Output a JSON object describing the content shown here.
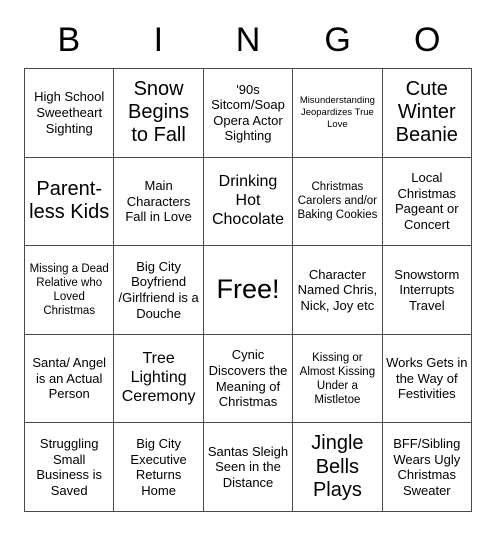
{
  "header": {
    "letters": [
      "B",
      "I",
      "N",
      "G",
      "O"
    ]
  },
  "grid": {
    "rows": 5,
    "columns": 5,
    "border_color": "#4a4a4a",
    "background_color": "#ffffff",
    "text_color": "#000000",
    "cells": [
      {
        "text": "High School Sweetheart Sighting",
        "size": "fs-md"
      },
      {
        "text": "Snow Begins to Fall",
        "size": "fs-xl"
      },
      {
        "text": "'90s Sitcom/Soap Opera Actor Sighting",
        "size": "fs-md"
      },
      {
        "text": "Misunderstanding Jeopardizes True Love",
        "size": "fs-xs"
      },
      {
        "text": "Cute Winter Beanie",
        "size": "fs-xl"
      },
      {
        "text": "Parent-less Kids",
        "size": "fs-xl"
      },
      {
        "text": "Main Characters Fall in Love",
        "size": "fs-md"
      },
      {
        "text": "Drinking Hot Chocolate",
        "size": "fs-lg"
      },
      {
        "text": "Christmas Carolers and/or Baking Cookies",
        "size": "fs-sm"
      },
      {
        "text": "Local Christmas Pageant or Concert",
        "size": "fs-md"
      },
      {
        "text": "Missing a Dead Relative who Loved Christmas",
        "size": "fs-sm"
      },
      {
        "text": "Big City Boyfriend /Girlfriend is a Douche",
        "size": "fs-md"
      },
      {
        "text": "Free!",
        "size": "fs-free"
      },
      {
        "text": "Character Named Chris, Nick, Joy etc",
        "size": "fs-md"
      },
      {
        "text": "Snowstorm Interrupts Travel",
        "size": "fs-md"
      },
      {
        "text": "Santa/ Angel is an Actual Person",
        "size": "fs-md"
      },
      {
        "text": "Tree Lighting Ceremony",
        "size": "fs-lg"
      },
      {
        "text": "Cynic Discovers the Meaning of Christmas",
        "size": "fs-md"
      },
      {
        "text": "Kissing or Almost Kissing Under a Mistletoe",
        "size": "fs-sm"
      },
      {
        "text": "Works Gets in the Way of Festivities",
        "size": "fs-md"
      },
      {
        "text": "Struggling Small Business is Saved",
        "size": "fs-md"
      },
      {
        "text": "Big City Executive Returns Home",
        "size": "fs-md"
      },
      {
        "text": "Santas Sleigh Seen in the Distance",
        "size": "fs-md"
      },
      {
        "text": "Jingle Bells Plays",
        "size": "fs-xl"
      },
      {
        "text": "BFF/Sibling Wears Ugly Christmas Sweater",
        "size": "fs-md"
      }
    ]
  }
}
